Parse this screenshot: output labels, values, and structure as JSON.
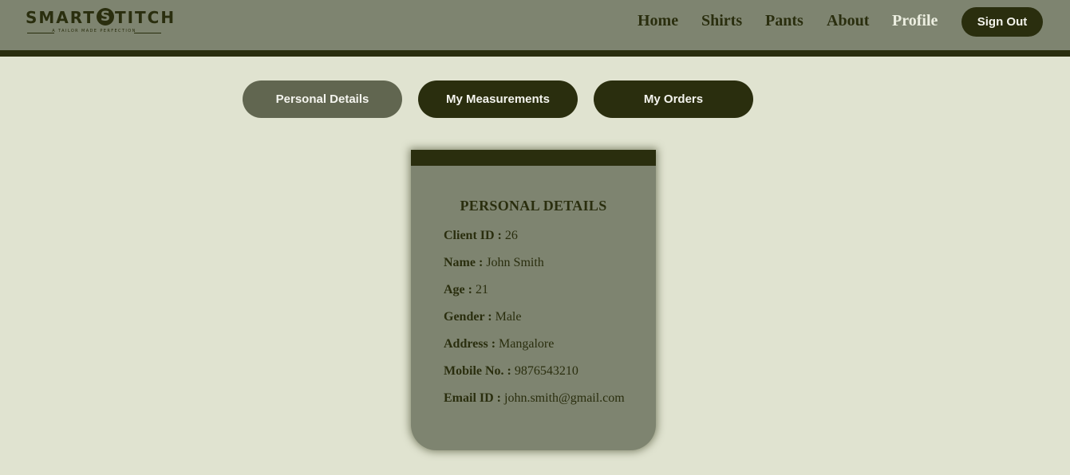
{
  "brand": {
    "name_before": "SMART",
    "name_s": "S",
    "name_after": "TITCH",
    "tagline": "A TAILOR MADE PERFECTION"
  },
  "nav": {
    "home": "Home",
    "shirts": "Shirts",
    "pants": "Pants",
    "about": "About",
    "profile": "Profile",
    "sign_out": "Sign Out"
  },
  "tabs": {
    "personal": "Personal Details",
    "measurements": "My Measurements",
    "orders": "My Orders"
  },
  "card": {
    "title": "PERSONAL DETAILS",
    "fields": [
      {
        "label": "Client ID :",
        "value": "26"
      },
      {
        "label": "Name :",
        "value": "John Smith"
      },
      {
        "label": "Age :",
        "value": "21"
      },
      {
        "label": "Gender :",
        "value": "Male"
      },
      {
        "label": "Address :",
        "value": "Mangalore"
      },
      {
        "label": "Mobile No. :",
        "value": "9876543210"
      },
      {
        "label": "Email ID :",
        "value": "john.smith@gmail.com"
      }
    ]
  },
  "colors": {
    "background": "#e0e3d0",
    "navbar": "#7e8470",
    "dark": "#2a2e0e",
    "active_tab": "#616650"
  }
}
